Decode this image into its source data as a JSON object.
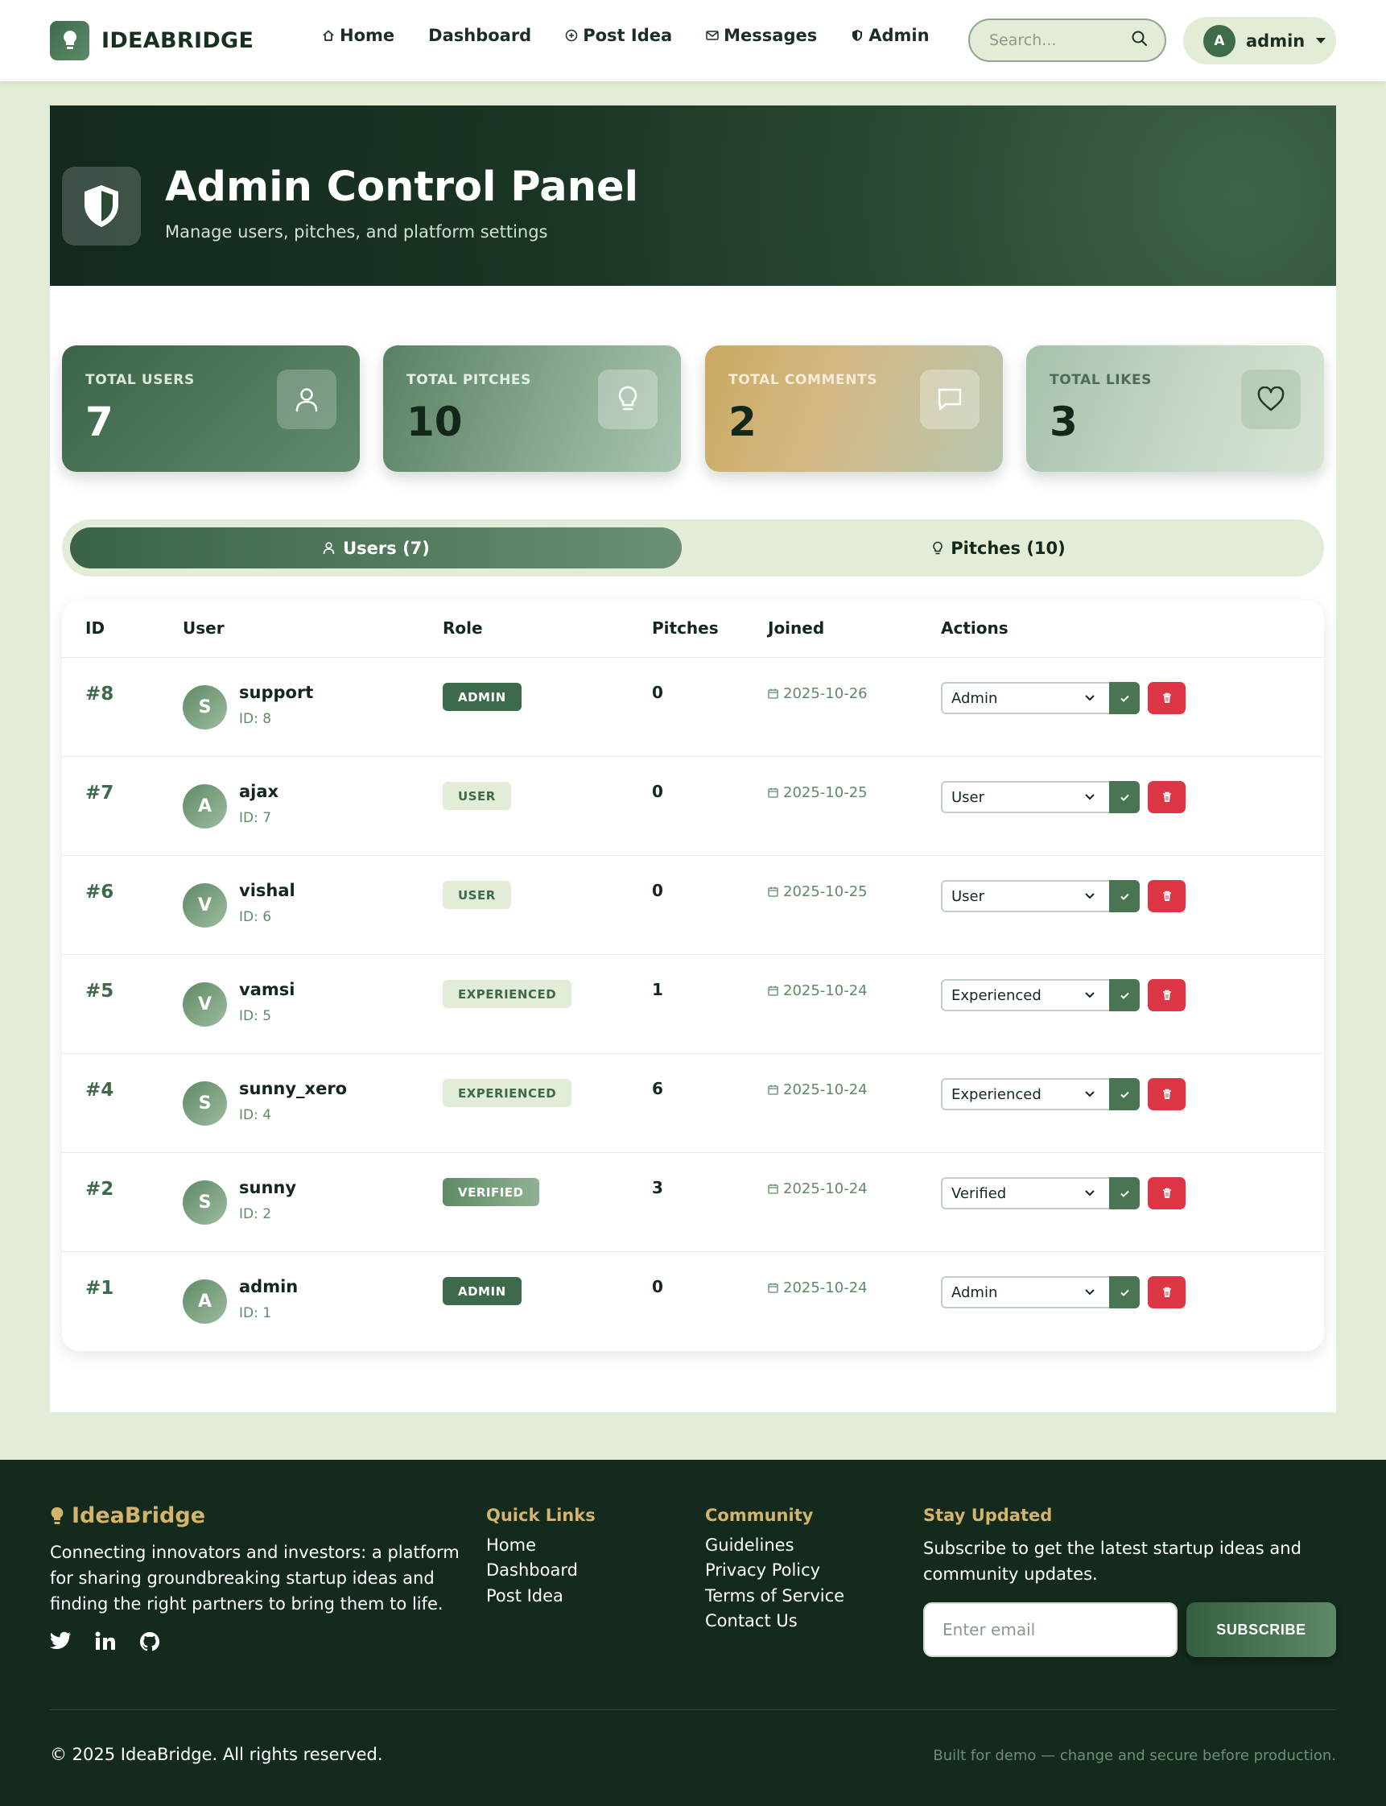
{
  "navbar": {
    "brand": "IDEABRIDGE",
    "links": [
      {
        "label": "Home",
        "icon": "home-icon"
      },
      {
        "label": "Dashboard",
        "icon": ""
      },
      {
        "label": "Post Idea",
        "icon": "plus-circle-icon"
      },
      {
        "label": "Messages",
        "icon": "envelope-icon"
      },
      {
        "label": "Admin",
        "icon": "shield-icon"
      }
    ],
    "search_placeholder": "Search...",
    "user": {
      "initial": "A",
      "name": "admin"
    }
  },
  "hero": {
    "title": "Admin Control Panel",
    "subtitle": "Manage users, pitches, and platform settings"
  },
  "stats": [
    {
      "label": "Total Users",
      "value": "7",
      "icon": "user-icon"
    },
    {
      "label": "Total Pitches",
      "value": "10",
      "icon": "lightbulb-icon"
    },
    {
      "label": "Total Comments",
      "value": "2",
      "icon": "comment-icon"
    },
    {
      "label": "Total Likes",
      "value": "3",
      "icon": "heart-icon"
    }
  ],
  "tabs": {
    "users": "Users (7)",
    "pitches": "Pitches (10)"
  },
  "table": {
    "headers": {
      "id": "ID",
      "user": "User",
      "role": "Role",
      "pitches": "Pitches",
      "joined": "Joined",
      "actions": "Actions"
    },
    "rows": [
      {
        "id": "#8",
        "initial": "S",
        "name": "support",
        "uid": "ID: 8",
        "role": "ADMIN",
        "pitches": "0",
        "joined": "2025-10-26",
        "select": "Admin"
      },
      {
        "id": "#7",
        "initial": "A",
        "name": "ajax",
        "uid": "ID: 7",
        "role": "USER",
        "pitches": "0",
        "joined": "2025-10-25",
        "select": "User"
      },
      {
        "id": "#6",
        "initial": "V",
        "name": "vishal",
        "uid": "ID: 6",
        "role": "USER",
        "pitches": "0",
        "joined": "2025-10-25",
        "select": "User"
      },
      {
        "id": "#5",
        "initial": "V",
        "name": "vamsi",
        "uid": "ID: 5",
        "role": "EXPERIENCED",
        "pitches": "1",
        "joined": "2025-10-24",
        "select": "Experienced"
      },
      {
        "id": "#4",
        "initial": "S",
        "name": "sunny_xero",
        "uid": "ID: 4",
        "role": "EXPERIENCED",
        "pitches": "6",
        "joined": "2025-10-24",
        "select": "Experienced"
      },
      {
        "id": "#2",
        "initial": "S",
        "name": "sunny",
        "uid": "ID: 2",
        "role": "VERIFIED",
        "pitches": "3",
        "joined": "2025-10-24",
        "select": "Verified"
      },
      {
        "id": "#1",
        "initial": "A",
        "name": "admin",
        "uid": "ID: 1",
        "role": "ADMIN",
        "pitches": "0",
        "joined": "2025-10-24",
        "select": "Admin"
      }
    ]
  },
  "footer": {
    "brand": "IdeaBridge",
    "description": "Connecting innovators and investors: a platform for sharing groundbreaking startup ideas and finding the right partners to bring them to life.",
    "quick_links": {
      "title": "Quick Links",
      "items": [
        "Home",
        "Dashboard",
        "Post Idea"
      ]
    },
    "community": {
      "title": "Community",
      "items": [
        "Guidelines",
        "Privacy Policy",
        "Terms of Service",
        "Contact Us"
      ]
    },
    "newsletter": {
      "title": "Stay Updated",
      "text": "Subscribe to get the latest startup ideas and community updates.",
      "placeholder": "Enter email",
      "button": "SUBSCRIBE"
    },
    "copyright": "© 2025 IdeaBridge. All rights reserved.",
    "note": "Built for demo — change and secure before production."
  },
  "colors": {
    "primary": "#3d6a4a",
    "dark": "#132a1d",
    "accent_gold": "#d4b36a",
    "background": "#e2ecd6",
    "danger": "#dc3545"
  }
}
